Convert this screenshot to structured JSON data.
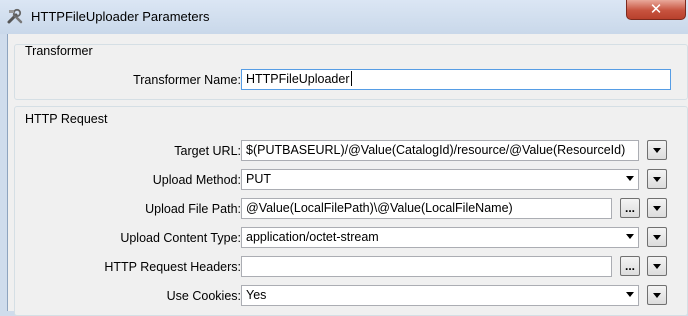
{
  "window": {
    "title": "HTTPFileUploader Parameters",
    "close_glyph": "✕"
  },
  "transformer_group": {
    "title": "Transformer",
    "name_label": "Transformer Name:",
    "name_value": "HTTPFileUploader"
  },
  "http_group": {
    "title": "HTTP Request",
    "rows": [
      {
        "label": "Target URL:",
        "value": "$(PUTBASEURL)/@Value(CatalogId)/resource/@Value(ResourceId)"
      },
      {
        "label": "Upload Method:",
        "value": "PUT"
      },
      {
        "label": "Upload File Path:",
        "value": "@Value(LocalFilePath)\\@Value(LocalFileName)"
      },
      {
        "label": "Upload Content Type:",
        "value": "application/octet-stream"
      },
      {
        "label": "HTTP Request Headers:",
        "value": ""
      },
      {
        "label": "Use Cookies:",
        "value": "Yes"
      }
    ]
  },
  "icons": {
    "browse_glyph": "...",
    "app_icon": "tools-icon",
    "menu_icon": "triangle-down-icon"
  }
}
